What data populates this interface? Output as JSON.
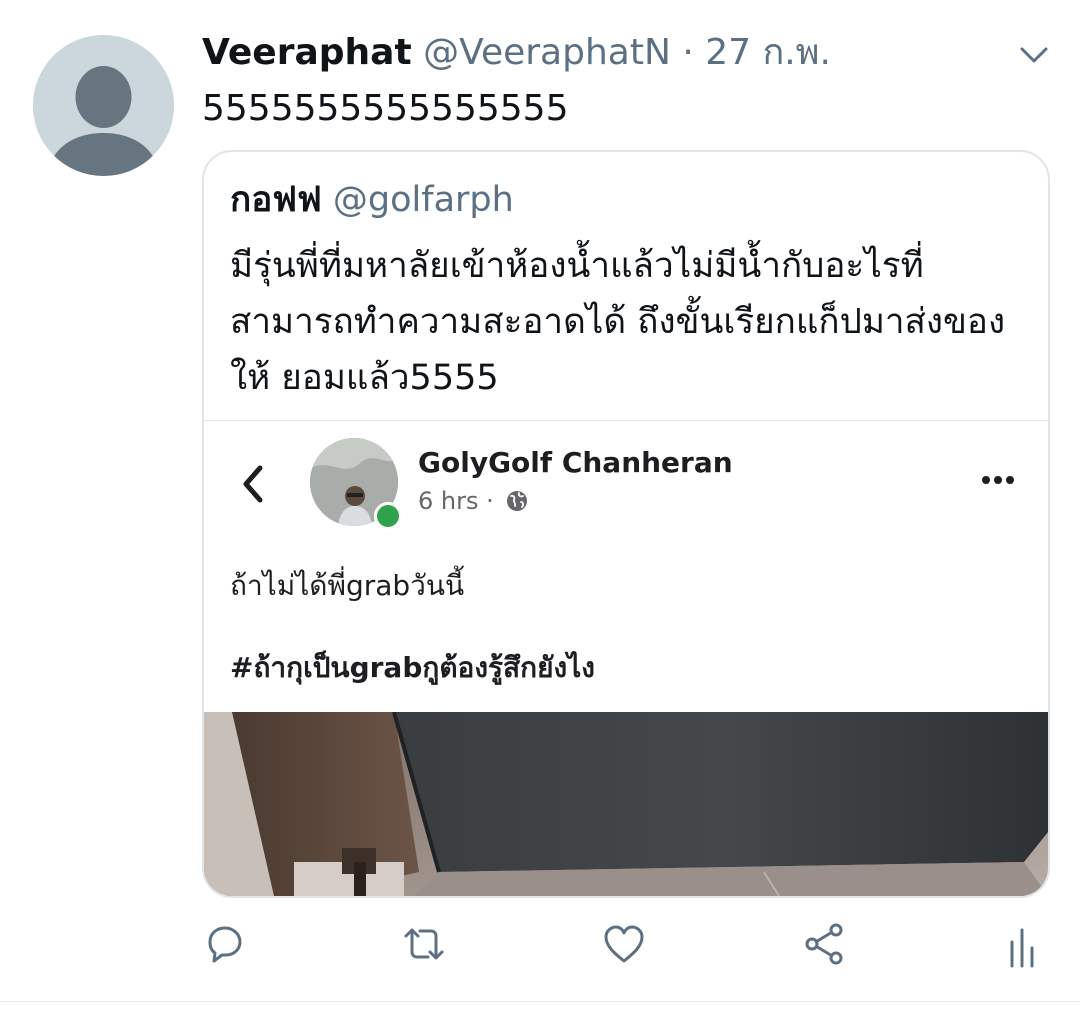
{
  "tweet": {
    "display_name": "Veeraphat",
    "handle": "@VeeraphatN",
    "separator": "·",
    "date": "27 ก.พ.",
    "text": "5555555555555555"
  },
  "quoted_tweet": {
    "display_name": "กอฟฟ",
    "handle": "@golfarph",
    "text": "มีรุ่นพี่ที่มหาลัยเข้าห้องน้ำแล้วไม่มีน้ำกับอะไรที่สามารถทำความสะอาดได้ ถึงขั้นเรียกแก็ปมาส่งของให้ ยอมแล้ว5555"
  },
  "facebook_post": {
    "author": "GolyGolf Chanheran",
    "time": "6 hrs ·",
    "post_text": "ถ้าไม่ได้พี่grabวันนี้",
    "hashtag": "#ถ้ากุเป็นgrabกูต้องรู้สึกยังไง"
  },
  "icons": {
    "caret": "chevron-down-icon",
    "reply": "reply-icon",
    "retweet": "retweet-icon",
    "like": "heart-icon",
    "share": "share-icon",
    "analytics": "analytics-icon"
  },
  "colors": {
    "text": "#0f1419",
    "secondary": "#5b7083",
    "icon": "#5b7083",
    "fb_online": "#31a24c"
  }
}
